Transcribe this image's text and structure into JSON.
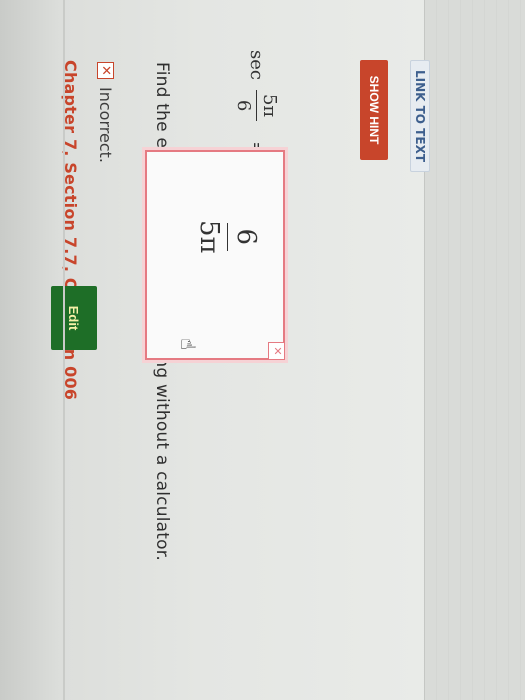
{
  "question": {
    "chapter_title": "Chapter 7, Section 7.7, Question 006",
    "status_label": "Incorrect.",
    "status_icon": "x-icon",
    "prompt": "Find the exact value of the following without a calculator.",
    "expression": {
      "function": "sec",
      "numerator": "5π",
      "denominator": "6",
      "equals": "="
    },
    "answer": {
      "numerator": "6",
      "denominator": "5π",
      "status_icon": "x-icon"
    },
    "edit_label": "Edit"
  },
  "actions": {
    "show_hint_label": "SHOW HINT",
    "link_to_text_label": "LINK TO TEXT"
  },
  "colors": {
    "accent": "#c8452b",
    "edit_button": "#1e6e27",
    "error_border": "#e57a82"
  }
}
